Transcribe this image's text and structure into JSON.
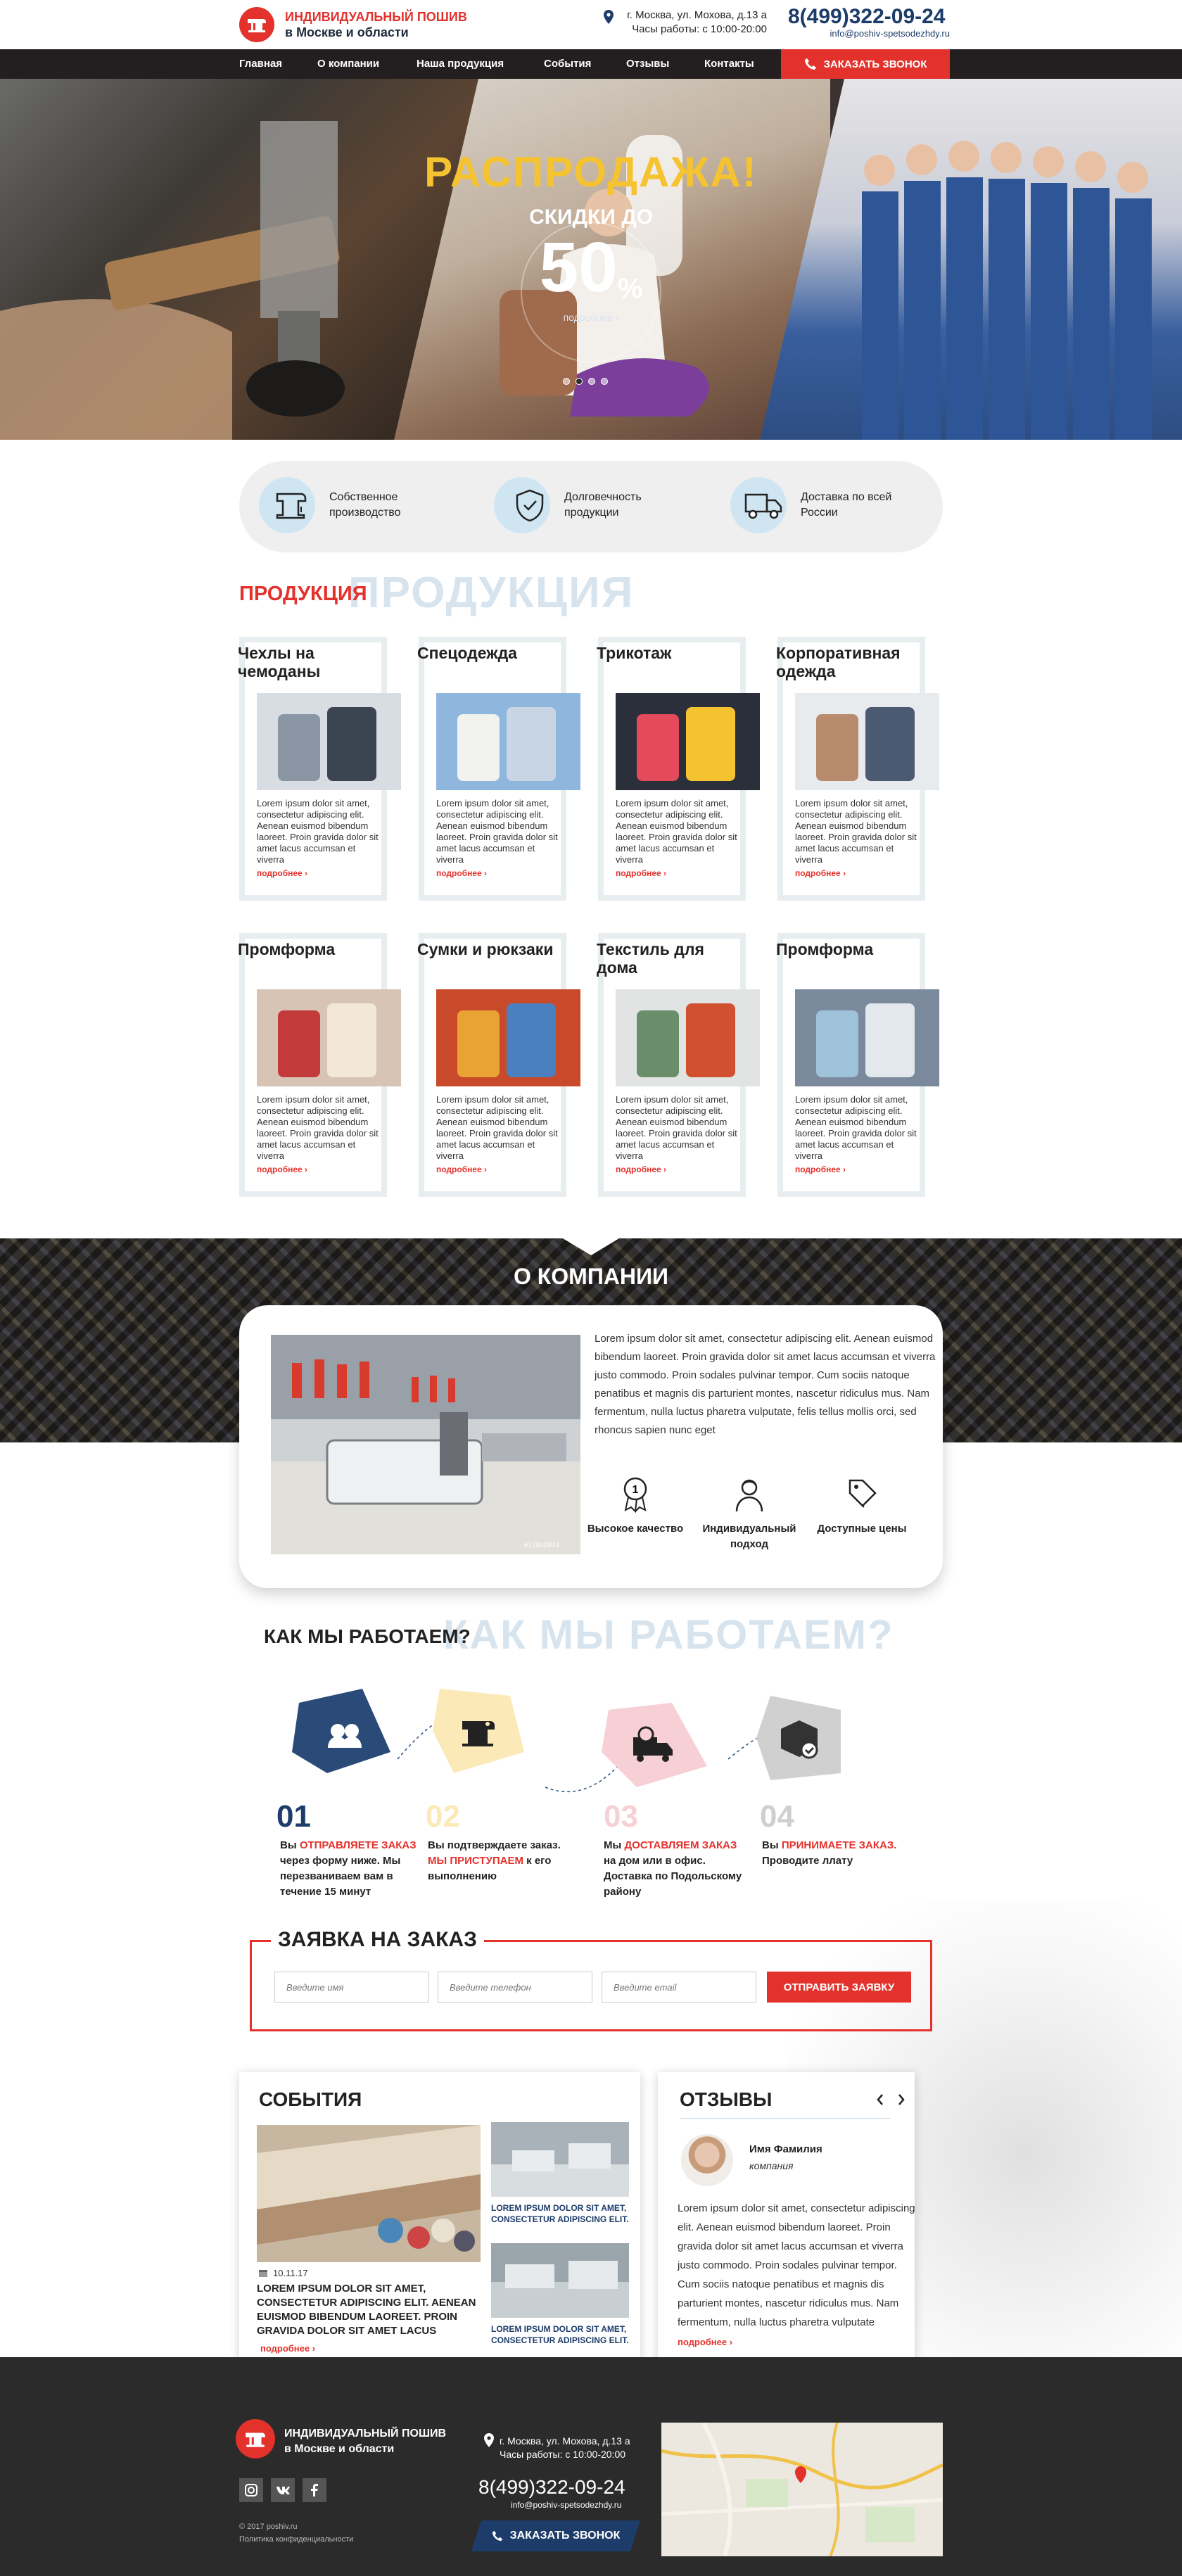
{
  "header": {
    "logo_line1": "ИНДИВИДУАЛЬНЫЙ ПОШИВ",
    "logo_line2": "в Москве и области",
    "address": "г. Москва, ул. Мохова, д.13 а",
    "hours": "Часы работы: с 10:00-20:00",
    "phone": "8(499)322-09-24",
    "email": "info@poshiv-spetsodezhdy.ru"
  },
  "nav": {
    "items": [
      "Главная",
      "О компании",
      "Наша продукция",
      "События",
      "Отзывы",
      "Контакты"
    ],
    "call_button": "ЗАКАЗАТЬ ЗВОНОК"
  },
  "hero": {
    "title": "РАСПРОДАЖА!",
    "subtitle": "СКИДКИ ДО",
    "percent": "50",
    "percent_sign": "%",
    "more": "подробнее ›",
    "active_slide": 2,
    "slides_count": 4
  },
  "features": [
    {
      "icon": "sewing-machine-icon",
      "text": "Собственное производство"
    },
    {
      "icon": "shield-icon",
      "text": "Долговечность продукции"
    },
    {
      "icon": "truck-icon",
      "text": "Доставка по всей России"
    }
  ],
  "products": {
    "title": "ПРОДУКЦИЯ",
    "ghost_title": "ПРОДУКЦИЯ",
    "desc": "Lorem ipsum dolor sit amet, consectetur adipiscing elit. Aenean euismod bibendum laoreet. Proin gravida dolor sit amet lacus accumsan et viverra",
    "more": "подробнее ›",
    "items": [
      {
        "title": "Чехлы на чемоданы"
      },
      {
        "title": "Спецодежда"
      },
      {
        "title": "Трикотаж"
      },
      {
        "title": "Корпоративная одежда"
      },
      {
        "title": "Промформа"
      },
      {
        "title": "Сумки и рюкзаки"
      },
      {
        "title": "Текстиль для дома"
      },
      {
        "title": "Промформа"
      }
    ]
  },
  "about": {
    "title": "О КОМПАНИИ",
    "text": "Lorem ipsum dolor sit amet, consectetur adipiscing elit. Aenean euismod bibendum laoreet. Proin gravida dolor sit amet lacus accumsan et viverra justo commodo. Proin sodales pulvinar tempor. Cum sociis natoque penatibus et magnis dis parturient montes, nascetur ridiculus mus. Nam fermentum, nulla luctus pharetra vulputate, felis tellus mollis orci, sed rhoncus sapien nunc eget",
    "image_caption": "#17842874",
    "advantages": [
      "Высокое качество",
      "Индивидуальный подход",
      "Доступные цены"
    ]
  },
  "how": {
    "title": "КАК МЫ РАБОТАЕМ?",
    "ghost_title": "КАК МЫ РАБОТАЕМ?",
    "steps": [
      {
        "num": "01",
        "pre": "Вы ",
        "hi": "ОТПРАВЛЯЕТЕ ЗАКАЗ",
        "post": " через форму ниже. Мы перезваниваем вам в течение 15 минут"
      },
      {
        "num": "02",
        "pre": "Вы подтверждаете заказ. ",
        "hi": "МЫ ПРИСТУПАЕМ",
        "post": " к его выполнению"
      },
      {
        "num": "03",
        "pre": "Мы ",
        "hi": "ДОСТАВЛЯЕМ ЗАКАЗ",
        "post": " на дом или в офис. Доставка по Подольскому району"
      },
      {
        "num": "04",
        "pre": "Вы ",
        "hi": "ПРИНИМАЕТЕ ЗАКАЗ.",
        "post": " Проводите ллату"
      }
    ]
  },
  "order": {
    "title": "ЗАЯВКА НА ЗАКАЗ",
    "name_placeholder": "Введите имя",
    "phone_placeholder": "Введите телефон",
    "email_placeholder": "Введите email",
    "button": "ОТПРАВИТЬ ЗАЯВКУ"
  },
  "events": {
    "title": "СОБЫТИЯ",
    "date": "10.11.17",
    "big_text": "LOREM IPSUM DOLOR SIT AMET, CONSECTETUR ADIPISCING ELIT. AENEAN EUISMOD BIBENDUM LAOREET. PROIN GRAVIDA DOLOR SIT AMET LACUS",
    "small_text_1": "LOREM IPSUM DOLOR SIT AMET, CONSECTETUR ADIPISCING ELIT.",
    "small_text_2": "LOREM IPSUM DOLOR SIT AMET, CONSECTETUR ADIPISCING ELIT.",
    "more": "подробнее ›"
  },
  "reviews": {
    "title": "ОТЗЫВЫ",
    "name": "Имя Фамилия",
    "company": "компания",
    "text": "Lorem ipsum dolor sit amet, consectetur adipiscing elit. Aenean euismod bibendum laoreet. Proin gravida dolor sit amet lacus accumsan et viverra justo commodo. Proin sodales pulvinar tempor. Cum sociis natoque penatibus et magnis dis parturient montes, nascetur ridiculus mus. Nam fermentum, nulla luctus pharetra vulputate",
    "more": "подробнее ›"
  },
  "footer": {
    "logo_line1": "ИНДИВИДУАЛЬНЫЙ ПОШИВ",
    "logo_line2": "в Москве и области",
    "address": "г. Москва, ул. Мохова, д.13 а",
    "hours": "Часы работы: с 10:00-20:00",
    "phone": "8(499)322-09-24",
    "email": "info@poshiv-spetsodezhdy.ru",
    "copyright": "© 2017 poshiv.ru",
    "policy": "Политика конфиденциальности",
    "call_button": "ЗАКАЗАТЬ ЗВОНОК"
  },
  "colors": {
    "accent": "#e3312c",
    "navy": "#1d3c6a",
    "nav_bg": "#231f20",
    "hero_title": "#f6c330"
  }
}
